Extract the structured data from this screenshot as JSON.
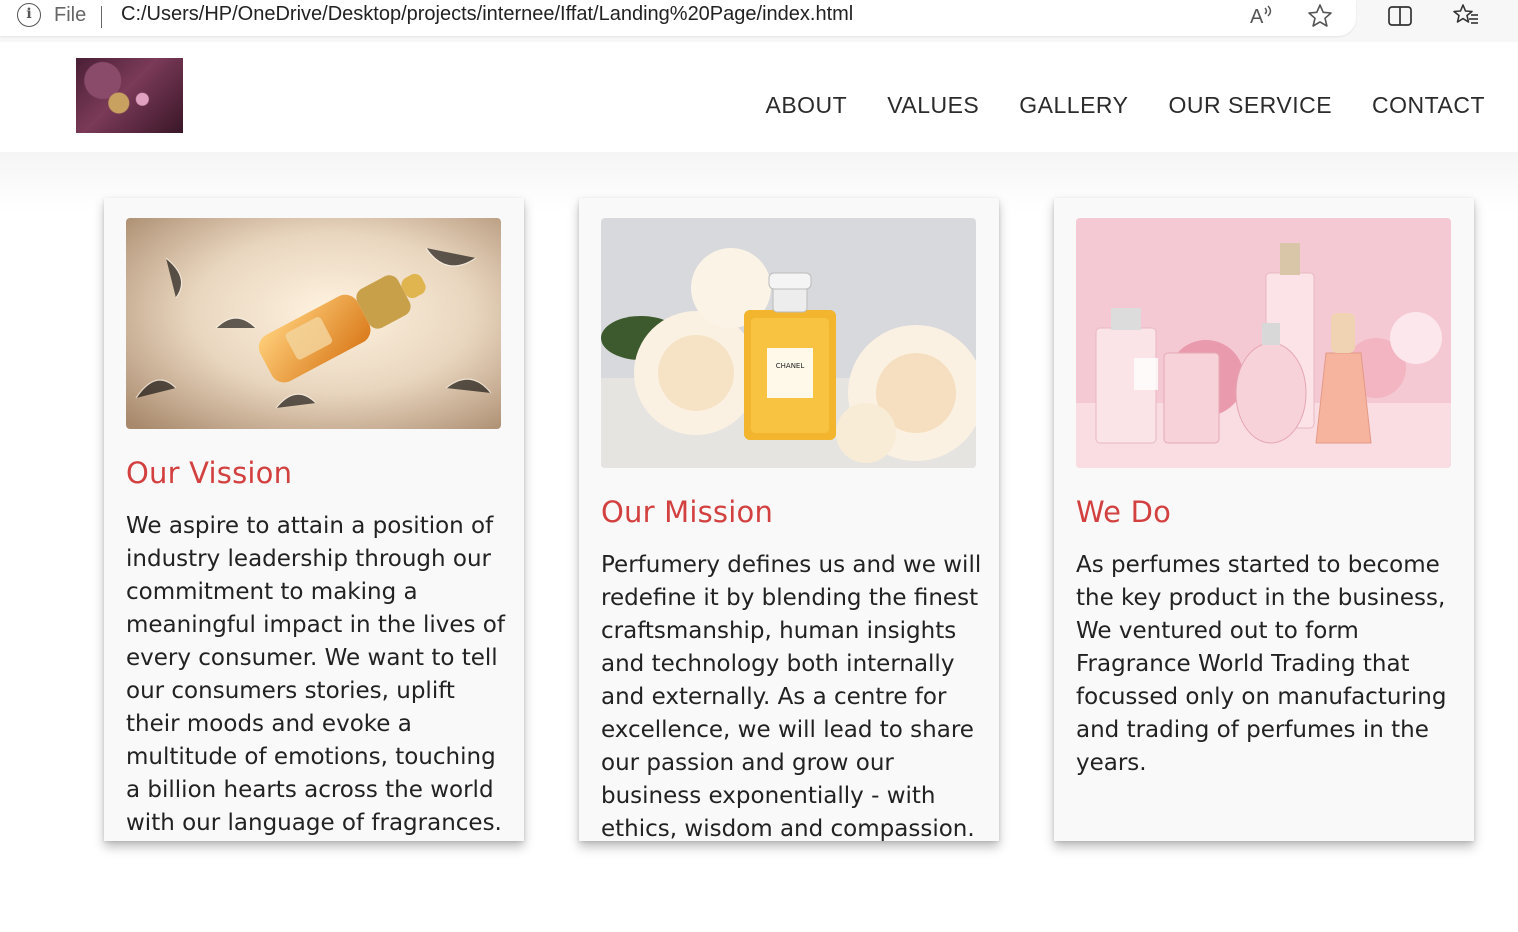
{
  "browser": {
    "file_label": "File",
    "url": "C:/Users/HP/OneDrive/Desktop/projects/internee/Iffat/Landing%20Page/index.html",
    "icons": [
      "info-icon",
      "read-aloud-icon",
      "favorite-star-icon",
      "split-screen-icon",
      "favorites-list-icon"
    ]
  },
  "nav": {
    "items": [
      "ABOUT",
      "VALUES",
      "GALLERY",
      "OUR SERVICE",
      "CONTACT"
    ]
  },
  "colors": {
    "title_red": "#d34040",
    "nav_text": "#2b2b2b"
  },
  "cards": [
    {
      "image": "perfume-bottle-on-fur",
      "title": "Our Vission",
      "text": "We aspire to attain a position of industry leadership through our commitment to making a meaningful impact in the lives of every consumer. We want to tell our consumers stories, uplift their moods and evoke a multitude of emotions, touching a billion hearts across the world with our language of fragrances."
    },
    {
      "image": "chanel-perfume-with-roses",
      "title": "Our Mission",
      "text": "Perfumery defines us and we will redefine it by blending the finest craftsmanship, human insights and technology both internally and externally. As a centre for excellence, we will lead to share our passion and grow our business exponentially - with ethics, wisdom and compassion."
    },
    {
      "image": "pink-perfume-bottles",
      "title": "We Do",
      "text": "As perfumes started to become the key product in the business, We ventured out to form Fragrance World Trading that focussed only on manufacturing and trading of perfumes in the years."
    }
  ]
}
